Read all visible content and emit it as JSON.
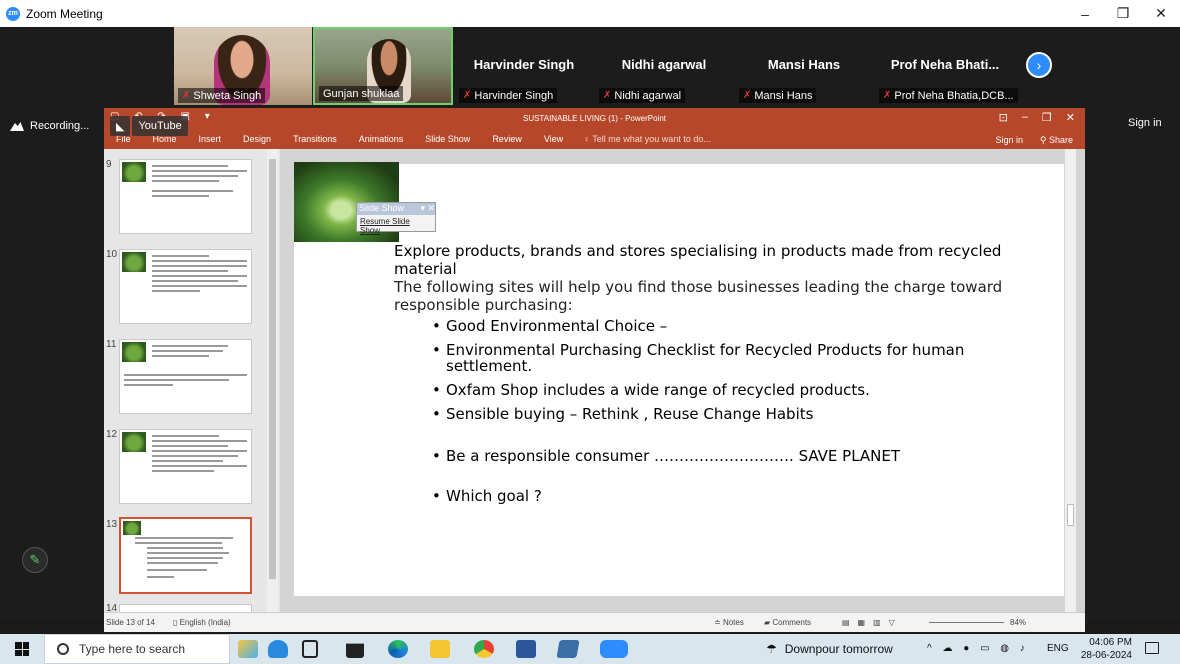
{
  "zoom": {
    "window_title": "Zoom Meeting",
    "recording": "Recording...",
    "sign_in": "Sign in"
  },
  "participants": [
    {
      "name": "Shweta Singh",
      "muted": true,
      "video": true
    },
    {
      "name": "Gunjan shuklaa",
      "muted": false,
      "video": true
    },
    {
      "name": "Harvinder Singh",
      "display": "Harvinder Singh",
      "muted": true,
      "video": false
    },
    {
      "name": "Nidhi agarwal",
      "display": "Nidhi agarwal",
      "muted": true,
      "video": false
    },
    {
      "name": "Mansi Hans",
      "display": "Mansi Hans",
      "muted": true,
      "video": false
    },
    {
      "name": "Prof Neha Bhatia,DCB...",
      "display": "Prof Neha Bhati...",
      "muted": true,
      "video": false
    }
  ],
  "youtube_overlay": {
    "label": "YouTube"
  },
  "ppt": {
    "title": "SUSTAINABLE LIVING (1) - PowerPoint",
    "sign_in": "Sign in",
    "share": "Share",
    "tabs": [
      "File",
      "Home",
      "Insert",
      "Design",
      "Transitions",
      "Animations",
      "Slide Show",
      "Review",
      "View"
    ],
    "tell_me": "Tell me what you want to do...",
    "thumb_numbers": [
      "9",
      "10",
      "11",
      "12",
      "13",
      "14"
    ],
    "slideshow_popup": {
      "title": "Slide Show",
      "action": "Resume Slide Show"
    },
    "slide": {
      "heading": "Explore products, brands and stores specialising in products made from recycled material",
      "paragraph": "The following sites will help you find those businesses leading the charge toward responsible purchasing:",
      "bullets": [
        "Good Environmental Choice –",
        "Environmental Purchasing Checklist for Recycled Products for human settlement.",
        "Oxfam Shop includes a wide range of recycled products.",
        "Sensible buying – Rethink , Reuse Change Habits",
        "Be a responsible consumer ………………………. SAVE PLANET",
        "Which goal ?"
      ]
    },
    "status": {
      "slide_of": "Slide 13 of 14",
      "language": "English (India)",
      "notes": "Notes",
      "comments": "Comments",
      "zoom": "84%"
    }
  },
  "taskbar": {
    "search_placeholder": "Type here to search",
    "weather": "Downpour tomorrow",
    "lang": "ENG",
    "time": "04:06 PM",
    "date": "28-06-2024"
  }
}
